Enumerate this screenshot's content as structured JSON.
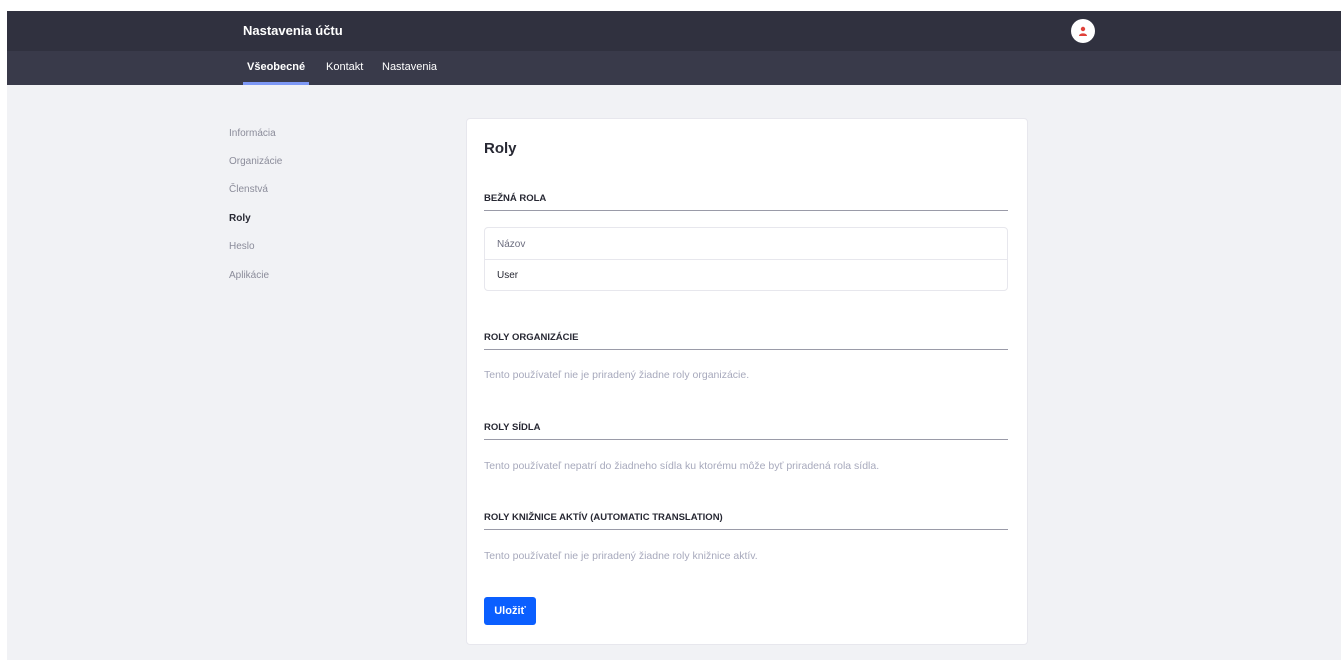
{
  "header": {
    "title": "Nastavenia účtu",
    "avatar_icon": "user-icon",
    "avatar_color": "#e0413a"
  },
  "nav": {
    "tabs": [
      {
        "label": "Všeobecné",
        "active": true
      },
      {
        "label": "Kontakt",
        "active": false
      },
      {
        "label": "Nastavenia",
        "active": false
      }
    ]
  },
  "sidebar": {
    "items": [
      {
        "label": "Informácia",
        "active": false
      },
      {
        "label": "Organizácie",
        "active": false
      },
      {
        "label": "Členstvá",
        "active": false
      },
      {
        "label": "Roly",
        "active": true
      },
      {
        "label": "Heslo",
        "active": false
      },
      {
        "label": "Aplikácie",
        "active": false
      }
    ]
  },
  "main": {
    "title": "Roly",
    "sections": {
      "regular": {
        "heading": "BEŽNÁ ROLA",
        "table": {
          "header": "Názov",
          "rows": [
            "User"
          ]
        }
      },
      "organization": {
        "heading": "ROLY ORGANIZÁCIE",
        "empty_message": "Tento používateľ nie je priradený žiadne roly organizácie."
      },
      "site": {
        "heading": "ROLY SÍDLA",
        "empty_message": "Tento používateľ nepatrí do žiadneho sídla ku ktorému môže byť priradená rola sídla."
      },
      "asset_library": {
        "heading": "ROLY KNIŽNICE AKTÍV (AUTOMATIC TRANSLATION)",
        "empty_message": "Tento používateľ nie je priradený žiadne roly knižnice aktív."
      }
    },
    "save_label": "Uložiť"
  },
  "colors": {
    "header_bg": "#30313f",
    "nav_bg": "#393a4a",
    "nav_active_indicator": "#7d98f5",
    "page_bg": "#f1f2f5",
    "primary": "#0b5fff",
    "muted_text": "#a7a9bc"
  }
}
